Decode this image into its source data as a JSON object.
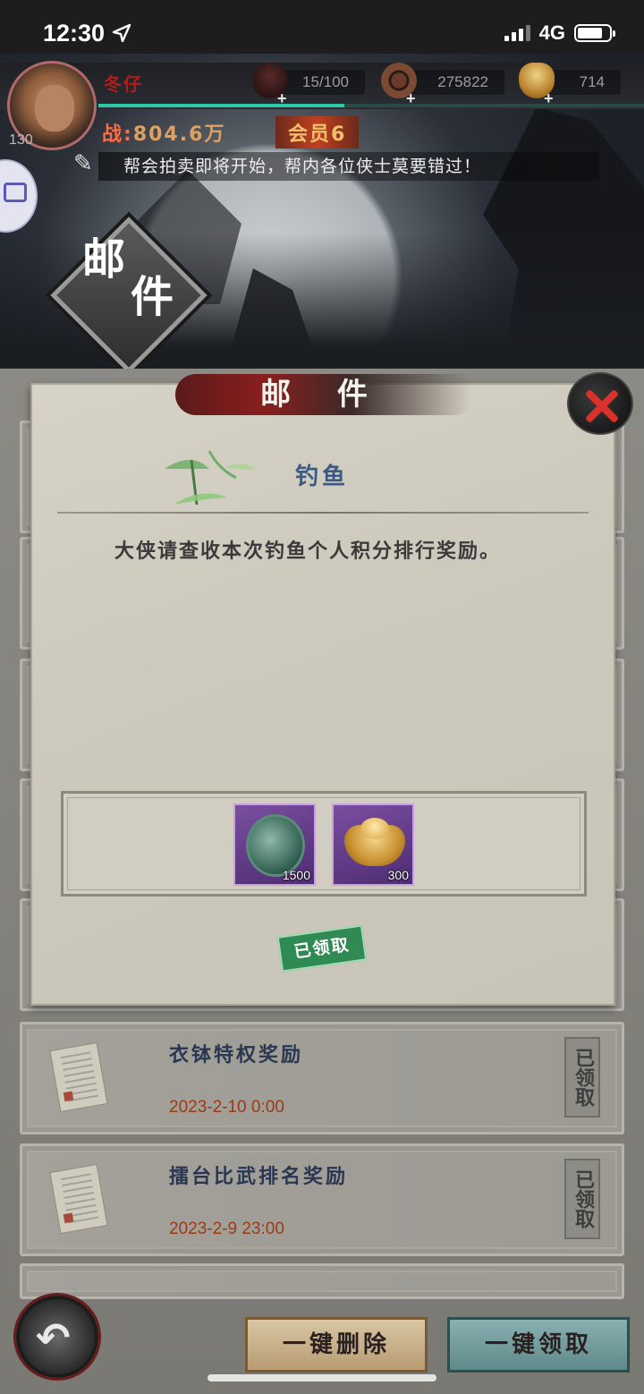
{
  "status_bar": {
    "time": "12:30",
    "network": "4G",
    "icons": [
      "location-arrow-icon",
      "signal-icon",
      "battery-icon"
    ]
  },
  "player": {
    "name": "冬仔",
    "level": "130",
    "power_prefix": "战:",
    "power_value": "804.6万",
    "vip": "会员6"
  },
  "resources": [
    {
      "icon": "potion-jar-icon",
      "value": "15/100"
    },
    {
      "icon": "copper-coin-icon",
      "value": "275822"
    },
    {
      "icon": "gold-ingot-icon",
      "value": "714"
    }
  ],
  "notice": {
    "text": "帮会拍卖即将开始，帮内各位侠士莫要错过！",
    "icon": "scroll-quill-icon"
  },
  "banner": {
    "seal_line1": "邮",
    "seal_line2": "件"
  },
  "modal": {
    "title": "邮 件",
    "mail_title": "钓鱼",
    "mail_body": "大侠请查收本次钓鱼个人积分排行奖励。",
    "rewards": [
      {
        "icon": "medal-icon",
        "qty": "1500"
      },
      {
        "icon": "gold-ingot-icon",
        "qty": "300"
      }
    ],
    "claimed_label": "已领取"
  },
  "mail_list": [
    {
      "title": "衣钵特权奖励",
      "date": "2023-2-10 0:00",
      "status": "已领取"
    },
    {
      "title": "擂台比武排名奖励",
      "date": "2023-2-9 23:00",
      "status": "已领取"
    }
  ],
  "buttons": {
    "delete_all": "一键删除",
    "claim_all": "一键领取"
  },
  "colors": {
    "accent_red": "#b21d1d",
    "mail_title_blue": "#3c5a84",
    "date_orange": "#9a3a16",
    "claimed_green": "#2f8a54"
  }
}
